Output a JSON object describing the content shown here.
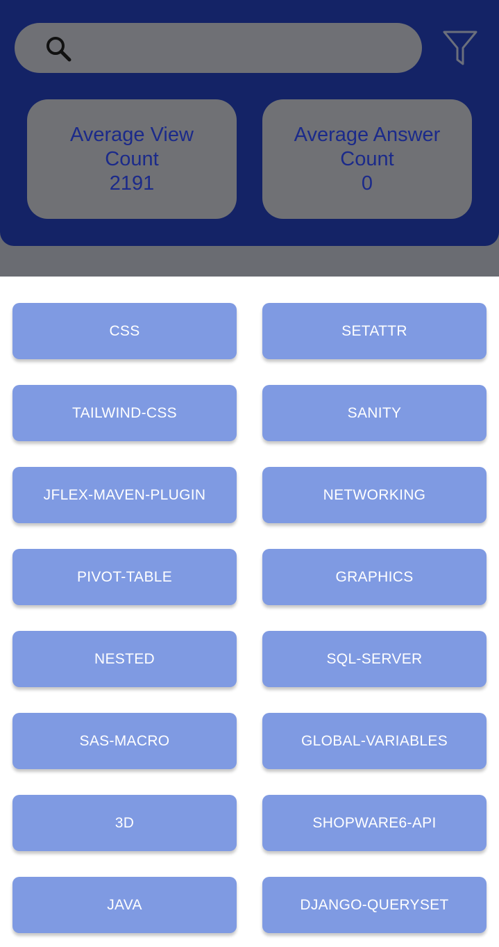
{
  "search": {
    "value": "",
    "placeholder": ""
  },
  "icons": {
    "search": "search-icon",
    "filter": "filter-icon"
  },
  "stats": {
    "view": {
      "label": "Average View Count",
      "value": "2191"
    },
    "answer": {
      "label": "Average Answer Count",
      "value": "0"
    }
  },
  "colors": {
    "header": "#142366",
    "card": "#707175",
    "card_text": "#1b2a8a",
    "tag": "#7f9ae2"
  },
  "tags": [
    "CSS",
    "SETATTR",
    "TAILWIND-CSS",
    "SANITY",
    "JFLEX-MAVEN-PLUGIN",
    "NETWORKING",
    "PIVOT-TABLE",
    "GRAPHICS",
    "NESTED",
    "SQL-SERVER",
    "SAS-MACRO",
    "GLOBAL-VARIABLES",
    "3D",
    "SHOPWARE6-API",
    "JAVA",
    "DJANGO-QUERYSET"
  ]
}
